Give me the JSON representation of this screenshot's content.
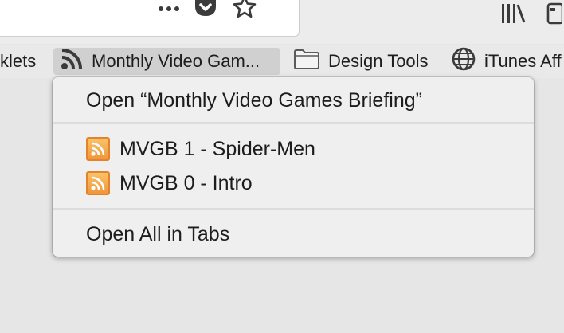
{
  "toolbar": {
    "icons": [
      "more-actions-icon",
      "pocket-icon",
      "bookmark-star-icon",
      "library-icon",
      "reader-icon"
    ]
  },
  "bookmarks_bar": {
    "items": [
      {
        "label": "klets",
        "icon": "none"
      },
      {
        "label": "Monthly Video Gam...",
        "icon": "rss-icon",
        "active": true
      },
      {
        "label": "Design Tools",
        "icon": "folder-icon"
      },
      {
        "label": "iTunes Aff",
        "icon": "globe-icon"
      }
    ]
  },
  "menu": {
    "open_feed_label": "Open “Monthly Video Games Briefing”",
    "entries": [
      {
        "label": "MVGB 1 - Spider-Men",
        "icon": "feed-icon"
      },
      {
        "label": "MVGB 0 - Intro",
        "icon": "feed-icon"
      }
    ],
    "open_all_label": "Open All in Tabs"
  },
  "colors": {
    "feed_orange": "#f0963a",
    "menu_background": "#efefef",
    "active_bookmark_background": "#d0d0d0"
  }
}
